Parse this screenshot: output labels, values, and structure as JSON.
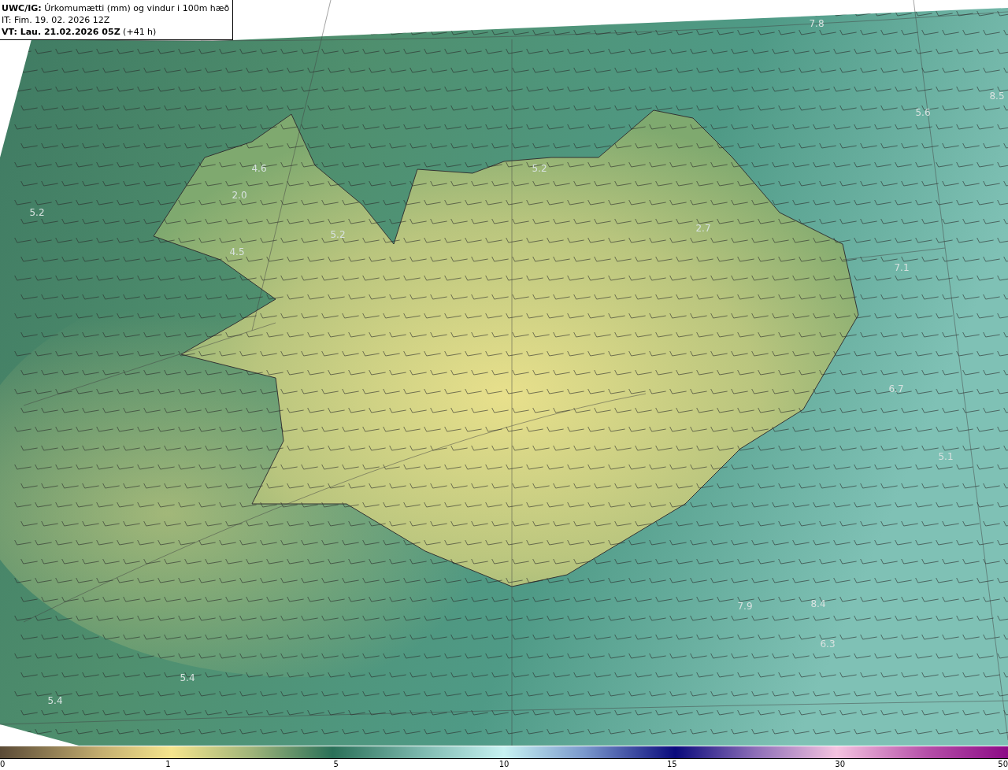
{
  "header": {
    "lines": [
      "**UWC/IG:** Úrkomumætti (mm) og vindur i 100m hæð",
      "IT: Fim. 19. 02. 2026 12Z",
      "**VT: Lau. 21.02.2026 05Z** (+41 h)"
    ]
  },
  "map_labels": [
    "7.8",
    "8.5",
    "5.6",
    "5.2",
    "4.6",
    "2.0",
    "5.2",
    "2.7",
    "5.2",
    "4.5",
    "7.1",
    "6.7",
    "5.1",
    "7.9",
    "8.4",
    "6.3",
    "5.4",
    "5.4"
  ],
  "colorbar": {
    "ticks": [
      "0",
      "1",
      "5",
      "10",
      "15",
      "30",
      "50"
    ]
  }
}
